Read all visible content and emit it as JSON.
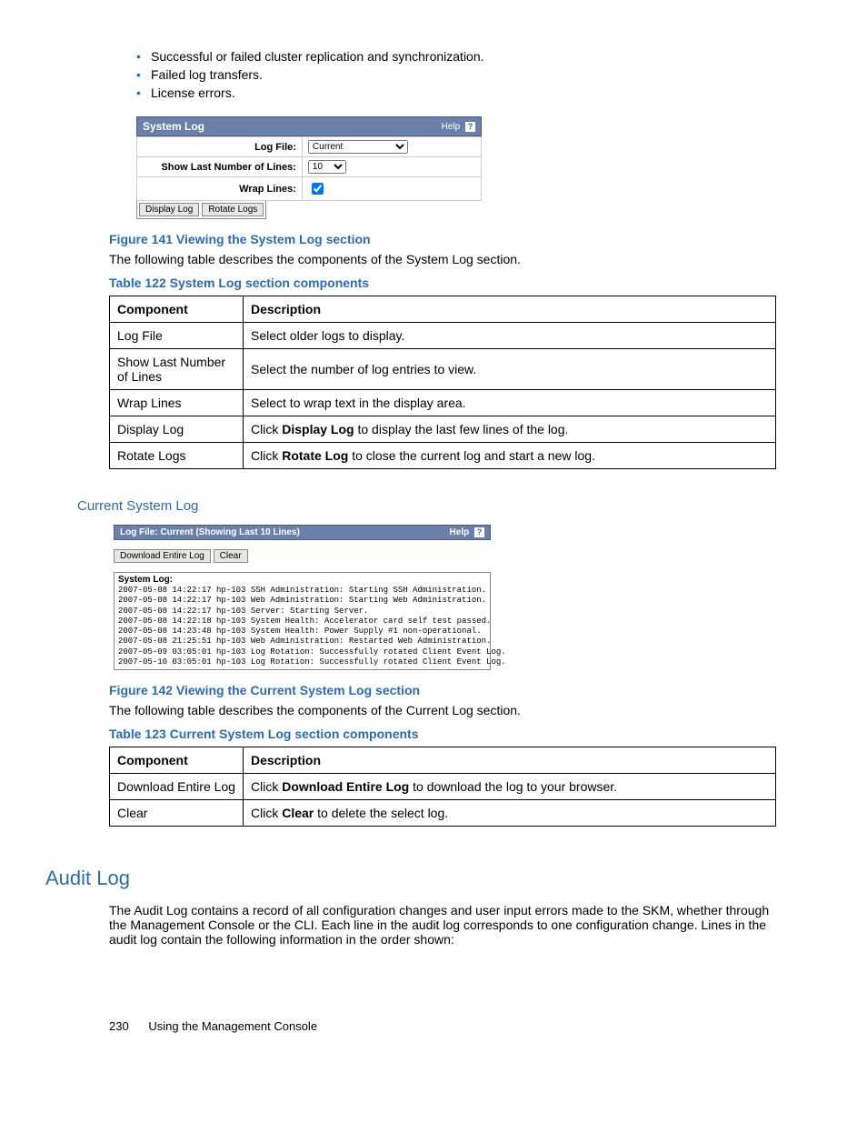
{
  "bullets": [
    "Successful or failed cluster replication and synchronization.",
    "Failed log transfers.",
    "License errors."
  ],
  "fig141": {
    "panel_title": "System Log",
    "help_text": "Help",
    "row_logfile_label": "Log File:",
    "row_logfile_value": "Current",
    "row_lines_label": "Show Last Number of Lines:",
    "row_lines_value": "10",
    "row_wrap_label": "Wrap Lines:",
    "btn_display": "Display Log",
    "btn_rotate": "Rotate Logs",
    "caption": "Figure 141 Viewing the System Log section"
  },
  "after_fig141": "The following table describes the components of the System Log section.",
  "table122": {
    "caption": "Table 122 System Log section components",
    "head_component": "Component",
    "head_description": "Description",
    "rows": [
      {
        "c": "Log File",
        "d_pre": "Select older logs to display.",
        "d_b": "",
        "d_post": ""
      },
      {
        "c": "Show Last Number of Lines",
        "d_pre": "Select the number of log entries to view.",
        "d_b": "",
        "d_post": ""
      },
      {
        "c": "Wrap Lines",
        "d_pre": "Select to wrap text in the display area.",
        "d_b": "",
        "d_post": ""
      },
      {
        "c": "Display Log",
        "d_pre": "Click ",
        "d_b": "Display Log",
        "d_post": " to display the last few lines of the log."
      },
      {
        "c": "Rotate Logs",
        "d_pre": "Click ",
        "d_b": "Rotate Log",
        "d_post": " to close the current log and start a new log."
      }
    ]
  },
  "current_log_heading": "Current System Log",
  "fig142": {
    "panel_title": "Log File: Current (Showing Last 10 Lines)",
    "help_text": "Help",
    "btn_download": "Download Entire Log",
    "btn_clear": "Clear",
    "log_label": "System Log:",
    "lines": [
      "2007-05-08 14:22:17 hp-103 SSH Administration: Starting SSH Administration.",
      "2007-05-08 14:22:17 hp-103 Web Administration: Starting Web Administration.",
      "2007-05-08 14:22:17 hp-103 Server: Starting Server.",
      "2007-05-08 14:22:18 hp-103 System Health: Accelerator card self test passed.",
      "2007-05-08 14:23:48 hp-103 System Health: Power Supply #1 non-operational.",
      "2007-05-08 21:25:51 hp-103 Web Administration: Restarted Web Administration.",
      "2007-05-09 03:05:01 hp-103 Log Rotation: Successfully rotated Client Event Log.",
      "2007-05-10 03:05:01 hp-103 Log Rotation: Successfully rotated Client Event Log."
    ],
    "caption": "Figure 142 Viewing the Current System Log section"
  },
  "after_fig142": "The following table describes the components of the Current Log section.",
  "table123": {
    "caption": "Table 123 Current System Log section components",
    "head_component": "Component",
    "head_description": "Description",
    "rows": [
      {
        "c": "Download Entire Log",
        "d_pre": "Click ",
        "d_b": "Download Entire Log",
        "d_post": " to download the log to your browser."
      },
      {
        "c": "Clear",
        "d_pre": "Click ",
        "d_b": "Clear",
        "d_post": " to delete the select log."
      }
    ]
  },
  "audit_heading": "Audit Log",
  "audit_para": "The Audit Log contains a record of all configuration changes and user input errors made to the SKM, whether through the Management Console or the CLI. Each line in the audit log corresponds to one configuration change. Lines in the audit log contain the following information in the order shown:",
  "footer": {
    "page": "230",
    "title": "Using the Management Console"
  }
}
